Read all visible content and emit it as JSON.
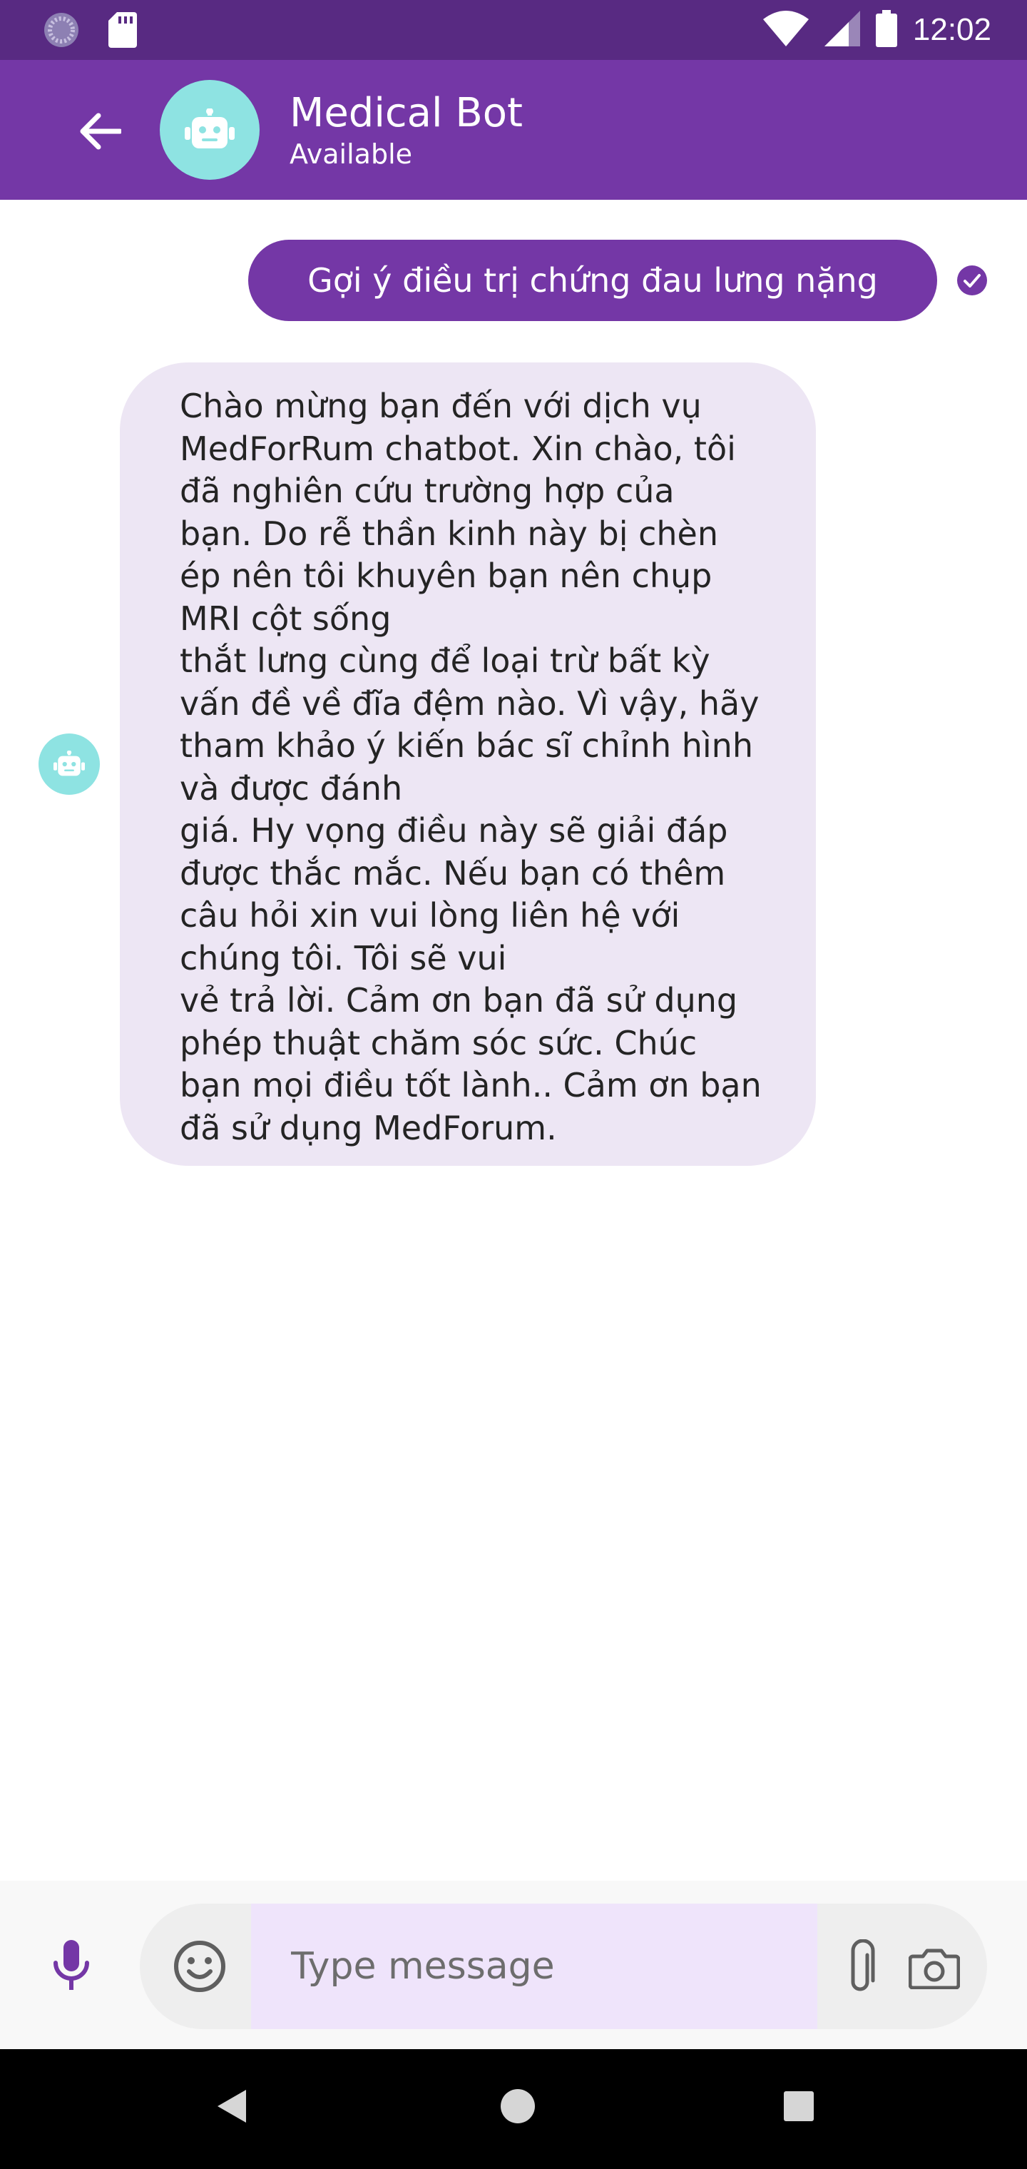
{
  "status_bar": {
    "time": "12:02",
    "icons": [
      "app-notification-icon",
      "sd-card-icon",
      "wifi-icon",
      "cell-signal-icon",
      "battery-icon"
    ]
  },
  "header": {
    "title": "Medical Bot",
    "status": "Available",
    "icons": [
      "back-arrow-icon",
      "robot-icon"
    ]
  },
  "chat": {
    "messages": [
      {
        "direction": "outgoing",
        "text": "Gợi ý điều trị chứng đau lưng nặng",
        "status_icon": "delivered-check-icon"
      },
      {
        "direction": "incoming",
        "text": "Chào mừng bạn đến với dịch vụ\nMedForRum chatbot. Xin chào, tôi\nđã nghiên cứu trường hợp của\nbạn. Do rễ thần kinh này bị chèn\nép nên tôi khuyên bạn nên chụp\nMRI cột sống\nthắt lưng cùng để loại trừ bất kỳ\nvấn đề về đĩa đệm nào. Vì vậy, hãy\ntham khảo ý kiến bác sĩ chỉnh hình\nvà được đánh\ngiá. Hy vọng điều này sẽ giải đáp\nđược thắc mắc. Nếu bạn có thêm\ncâu hỏi xin vui lòng liên hệ với\nchúng tôi. Tôi sẽ vui\nvẻ trả lời. Cảm ơn bạn đã sử dụng\nphép thuật chăm sóc sức. Chúc\nbạn mọi điều tốt lành.. Cảm ơn bạn\nđã sử dụng MedForum.",
        "avatar_icon": "robot-icon"
      }
    ]
  },
  "composer": {
    "placeholder": "Type message",
    "icons": [
      "microphone-icon",
      "emoji-icon",
      "paperclip-icon",
      "camera-icon"
    ]
  },
  "nav_bar": {
    "icons": [
      "nav-back-icon",
      "nav-home-icon",
      "nav-recents-icon"
    ]
  },
  "colors": {
    "status_bar": "#582a82",
    "app_bar": "#7437a6",
    "outgoing_bubble": "#7437a6",
    "incoming_bubble": "#ede6f4",
    "avatar": "#8ee3e2",
    "input_highlight": "#efe4fb"
  }
}
